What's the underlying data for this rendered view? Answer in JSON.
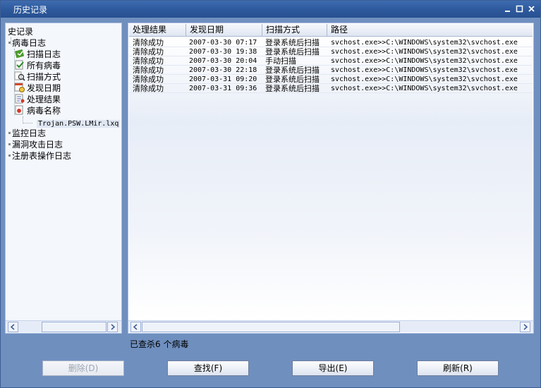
{
  "window": {
    "title": "历史记录"
  },
  "tree": {
    "root": "史记录",
    "items": [
      {
        "label": "病毒日志",
        "icon": "bullet-icon"
      },
      {
        "label": "扫描日志",
        "icon": "scan-log-icon"
      },
      {
        "label": "所有病毒",
        "icon": "all-virus-icon"
      },
      {
        "label": "扫描方式",
        "icon": "scan-method-icon"
      },
      {
        "label": "发现日期",
        "icon": "calendar-icon"
      },
      {
        "label": "处理结果",
        "icon": "result-icon"
      },
      {
        "label": "病毒名称",
        "icon": "virus-name-icon"
      },
      {
        "label": "Trojan.PSW.LMir.lxq",
        "icon": ""
      },
      {
        "label": "监控日志",
        "icon": "bullet-icon"
      },
      {
        "label": "漏洞攻击日志",
        "icon": "bullet-icon"
      },
      {
        "label": "注册表操作日志",
        "icon": "bullet-icon"
      }
    ]
  },
  "table": {
    "columns": [
      "处理结果",
      "发现日期",
      "扫描方式",
      "路径"
    ],
    "rows": [
      [
        "清除成功",
        "2007-03-30 07:17",
        "登录系统后扫描",
        "svchost.exe>>C:\\WINDOWS\\system32\\svchost.exe"
      ],
      [
        "清除成功",
        "2007-03-30 19:38",
        "登录系统后扫描",
        "svchost.exe>>C:\\WINDOWS\\system32\\svchost.exe"
      ],
      [
        "清除成功",
        "2007-03-30 20:04",
        "手动扫描",
        "svchost.exe>>C:\\WINDOWS\\system32\\svchost.exe"
      ],
      [
        "清除成功",
        "2007-03-30 22:18",
        "登录系统后扫描",
        "svchost.exe>>C:\\WINDOWS\\system32\\svchost.exe"
      ],
      [
        "清除成功",
        "2007-03-31 09:20",
        "登录系统后扫描",
        "svchost.exe>>C:\\WINDOWS\\system32\\svchost.exe"
      ],
      [
        "清除成功",
        "2007-03-31 09:36",
        "登录系统后扫描",
        "svchost.exe>>C:\\WINDOWS\\system32\\svchost.exe"
      ]
    ]
  },
  "status": {
    "text": "已查杀6  个病毒"
  },
  "buttons": {
    "delete": "删除(D)",
    "find": "查找(F)",
    "export": "导出(E)",
    "refresh": "刷新(R)"
  },
  "colors": {
    "window_bg": "#6f8fbf",
    "titlebar": "#2e5a9e",
    "pane_border": "#a9bde0"
  }
}
